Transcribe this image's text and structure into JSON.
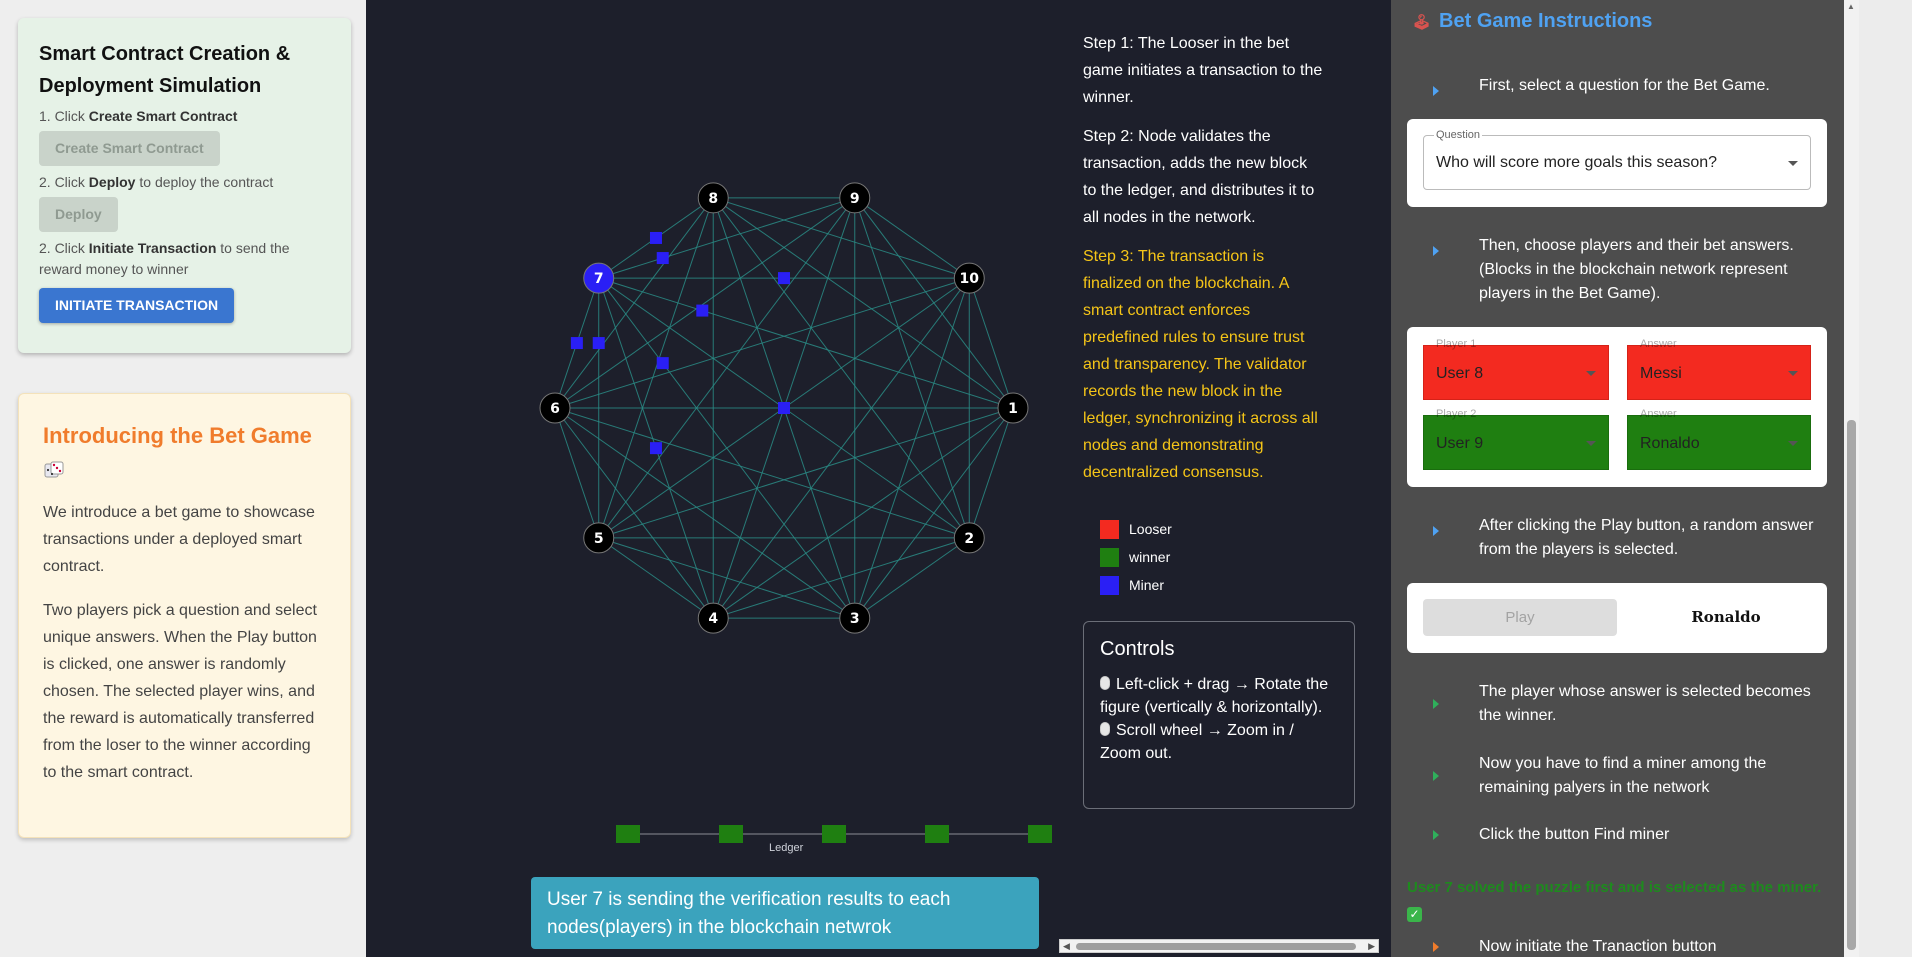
{
  "smart_contract": {
    "title": "Smart Contract Creation & Deployment Simulation",
    "step1_pre": "1. Click ",
    "step1_bold": "Create Smart Contract",
    "create_btn": "Create Smart Contract",
    "step2_pre": "2. Click ",
    "step2_bold": "Deploy",
    "step2_post": " to deploy the contract",
    "deploy_btn": "Deploy",
    "step3_pre": "2. Click ",
    "step3_bold": "Initiate Transaction",
    "step3_post": " to send the reward money to winner",
    "initiate_btn": "INITIATE TRANSACTION"
  },
  "bet_intro": {
    "title": "Introducing the Bet Game",
    "p1": "We introduce a bet game to showcase transactions under a deployed smart contract.",
    "p2": "Two players pick a question and select unique answers. When the Play button is clicked, one answer is randomly chosen. The selected player wins, and the reward is automatically transferred from the loser to the winner according to the smart contract."
  },
  "network": {
    "nodes": [
      {
        "label": "1",
        "role": "normal"
      },
      {
        "label": "2",
        "role": "normal"
      },
      {
        "label": "3",
        "role": "normal"
      },
      {
        "label": "4",
        "role": "normal"
      },
      {
        "label": "5",
        "role": "normal"
      },
      {
        "label": "6",
        "role": "normal"
      },
      {
        "label": "7",
        "role": "miner"
      },
      {
        "label": "8",
        "role": "normal"
      },
      {
        "label": "9",
        "role": "normal"
      },
      {
        "label": "10",
        "role": "normal"
      }
    ],
    "colors": {
      "edge": "#2a8b85",
      "node": "#000000",
      "miner": "#2a1ff5",
      "block": "#2a1ff5",
      "ledger_block": "#1f7f11"
    },
    "ledger_label": "Ledger",
    "ledger_blocks": 5
  },
  "steps": {
    "s1": "Step 1: The Looser in the bet game initiates a transaction to the winner.",
    "s2": "Step 2: Node validates the transaction, adds the new block to the ledger, and distributes it to all nodes in the network.",
    "s3": "Step 3: The transaction is finalized on the blockchain. A smart contract enforces predefined rules to ensure trust and transparency. The validator records the new block in the ledger, synchronizing it across all nodes and demonstrating decentralized consensus."
  },
  "legend": [
    {
      "label": "Looser",
      "color": "#f32a20"
    },
    {
      "label": "winner",
      "color": "#1f7f11"
    },
    {
      "label": "Miner",
      "color": "#2a1ff5"
    }
  ],
  "controls": {
    "title": "Controls",
    "line1": "Left-click + drag → Rotate the figure (vertically & horizontally).",
    "line2": "Scroll wheel → Zoom in / Zoom out."
  },
  "toast": "User 7 is sending the verification results to each nodes(players) in the blockchain netwrok",
  "instructions": {
    "title": "Bet Game Instructions",
    "i1": "First, select a question for the Bet Game.",
    "question_label": "Question",
    "question_value": "Who will score more goals this season?",
    "i2": "Then, choose players and their bet answers. (Blocks in the blockchain network represent players in the Bet Game).",
    "player1_label": "Player 1",
    "player1_value": "User 8",
    "answer1_label": "Answer",
    "answer1_value": "Messi",
    "player2_label": "Player 2",
    "player2_value": "User 9",
    "answer2_label": "Answer",
    "answer2_value": "Ronaldo",
    "i3": "After clicking the Play button, a random answer from the players is selected.",
    "play_btn": "Play",
    "play_result": "Ronaldo",
    "i4": "The player whose answer is selected becomes the winner.",
    "i5": "Now you have to find a miner among the remaining palyers in the network",
    "i6": "Click the button Find miner",
    "miner_msg": "User 7 solved the puzzle first and is selected as the miner.",
    "i7": "Now initiate the Tranaction button"
  }
}
